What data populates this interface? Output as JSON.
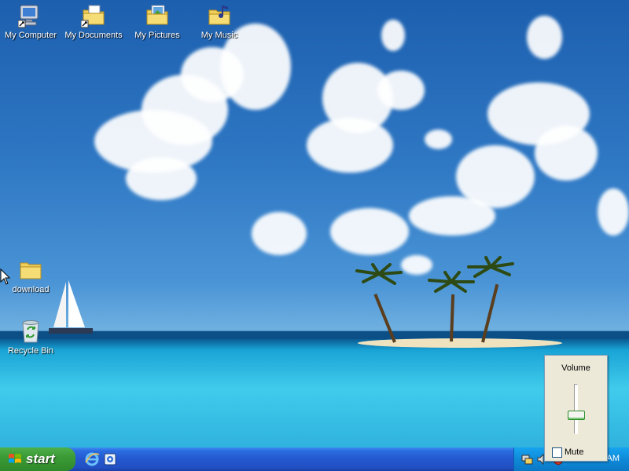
{
  "desktop": {
    "icons": [
      {
        "label": "My Computer"
      },
      {
        "label": "My Documents"
      },
      {
        "label": "My Pictures"
      },
      {
        "label": "My Music"
      },
      {
        "label": "download"
      },
      {
        "label": "Recycle Bin"
      }
    ]
  },
  "taskbar": {
    "start_label": "start",
    "quick_launch": [
      "internet-explorer-icon",
      "show-desktop-icon"
    ],
    "clock": "11:53 AM"
  },
  "volume_popup": {
    "title": "Volume",
    "mute_label": "Mute",
    "mute_checked": false,
    "level": 0.35
  },
  "colors": {
    "taskbar_blue": "#2457cf",
    "start_green": "#3c9a36",
    "tray_blue": "#0f8ad8"
  }
}
